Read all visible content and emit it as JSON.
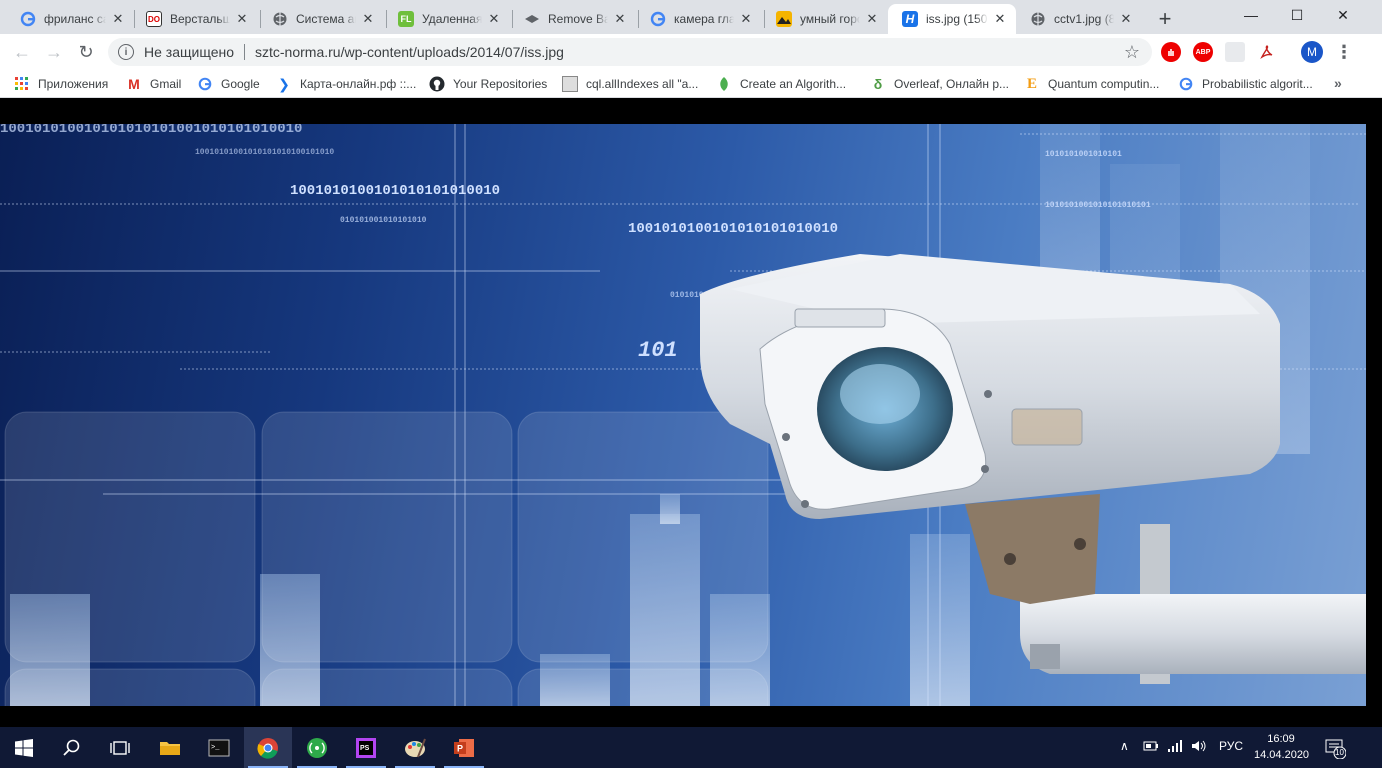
{
  "tabs": [
    {
      "title": "фриланс са",
      "favicon": "google-g"
    },
    {
      "title": "Верстальщ",
      "favicon": "do"
    },
    {
      "title": "Система ав",
      "favicon": "globe"
    },
    {
      "title": "Удаленная",
      "favicon": "fl"
    },
    {
      "title": "Remove Bac",
      "favicon": "remove-bg"
    },
    {
      "title": "камера гла",
      "favicon": "google-g"
    },
    {
      "title": "умный горс",
      "favicon": "image"
    },
    {
      "title": "iss.jpg (150",
      "favicon": "h",
      "active": true
    },
    {
      "title": "cctv1.jpg (8",
      "favicon": "globe"
    }
  ],
  "window": {
    "minimize": "—",
    "maximize": "☐",
    "close": "✕"
  },
  "toolbar": {
    "back": "←",
    "forward": "→",
    "reload": "↻",
    "security_label": "Не защищено",
    "url": "sztc-norma.ru/wp-content/uploads/2014/07/iss.jpg",
    "star": "☆",
    "avatar_letter": "M",
    "abp_label": "ABP"
  },
  "bookmarks": [
    {
      "label": "Приложения",
      "icon": "apps-grid"
    },
    {
      "label": "Gmail",
      "icon": "gmail"
    },
    {
      "label": "Google",
      "icon": "google-g"
    },
    {
      "label": "Карта-онлайн.рф ::...",
      "icon": "arrow"
    },
    {
      "label": "Your Repositories",
      "icon": "github"
    },
    {
      "label": "cql.allIndexes all \"a...",
      "icon": "image"
    },
    {
      "label": "Create an Algorith...",
      "icon": "leaf"
    },
    {
      "label": "Overleaf, Онлайн р...",
      "icon": "overleaf"
    },
    {
      "label": "Quantum computin...",
      "icon": "e-letter"
    },
    {
      "label": "Probabilistic algorit...",
      "icon": "google-g"
    }
  ],
  "bookmarks_more": "»",
  "image": {
    "binary_rows": [
      "100101010010101010101001010101010010",
      "10010101001010101010100101010",
      "1001010100101010101010010",
      "010101001010101010",
      "1001010100101010101010010",
      "0101010010101",
      "1010101001010101",
      "1010101001010101010101",
      "101"
    ]
  },
  "taskbar": {
    "tray_lang": "РУС",
    "time": "16:09",
    "date": "14.04.2020",
    "notifications": "10"
  },
  "colors": {
    "accent": "#1a73e8",
    "taskbar": "#101935",
    "tabstrip": "#dee1e6"
  }
}
